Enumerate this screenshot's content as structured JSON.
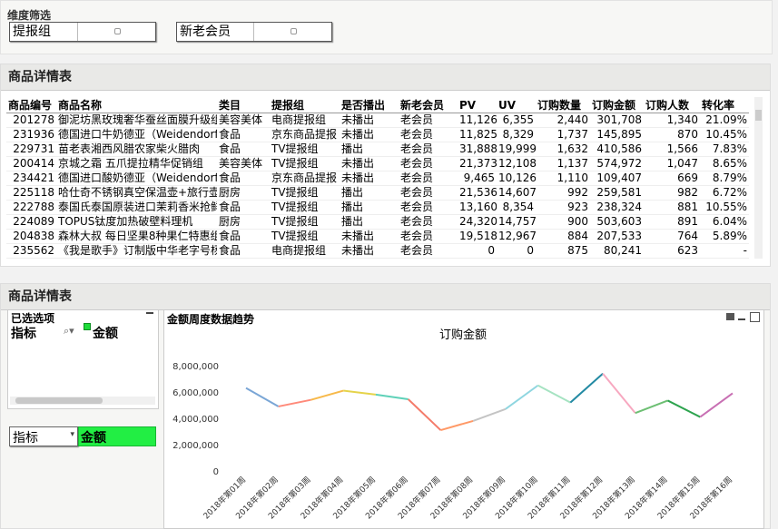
{
  "filter": {
    "title": "维度筛选",
    "combo1_label": "提报组",
    "combo2_label": "新老会员"
  },
  "table_panel": {
    "title": "商品详情表",
    "columns": [
      "商品编号",
      "商品名称",
      "类目",
      "提报组",
      "是否播出",
      "新老会员",
      "PV",
      "UV",
      "订购数量",
      "订购金额",
      "订购人数",
      "转化率"
    ],
    "rows": [
      [
        "201278",
        "御泥坊黑玫瑰奢华蚕丝面膜升级组",
        "美容美体",
        "电商提报组",
        "未播出",
        "老会员",
        "11,126",
        "6,355",
        "2,440",
        "301,708",
        "1,340",
        "21.09%"
      ],
      [
        "231936",
        "德国进口牛奶德亚（Weidendorf",
        "食品",
        "京东商品提报",
        "未播出",
        "老会员",
        "11,825",
        "8,329",
        "1,737",
        "145,895",
        "870",
        "10.45%"
      ],
      [
        "229731",
        "苗老表湘西风腊农家柴火腊肉",
        "食品",
        "TV提报组",
        "播出",
        "老会员",
        "31,888",
        "19,999",
        "1,632",
        "410,586",
        "1,566",
        "7.83%"
      ],
      [
        "200414",
        "京城之霜 五爪提拉精华促销组",
        "美容美体",
        "TV提报组",
        "未播出",
        "老会员",
        "21,373",
        "12,108",
        "1,137",
        "574,972",
        "1,047",
        "8.65%"
      ],
      [
        "234421",
        "德国进口酸奶德亚（Weidendorf",
        "食品",
        "京东商品提报",
        "未播出",
        "老会员",
        "9,465",
        "10,126",
        "1,110",
        "109,407",
        "669",
        "8.79%"
      ],
      [
        "225118",
        "哈仕奇不锈钢真空保温壶+旅行壶",
        "厨房",
        "TV提报组",
        "播出",
        "老会员",
        "21,536",
        "14,607",
        "992",
        "259,581",
        "982",
        "6.72%"
      ],
      [
        "222788",
        "泰国氏泰国原装进口茉莉香米抢鲜",
        "食品",
        "TV提报组",
        "播出",
        "老会员",
        "13,160",
        "8,354",
        "923",
        "238,324",
        "881",
        "10.55%"
      ],
      [
        "224089",
        "TOPUS钛度加热破壁料理机",
        "厨房",
        "TV提报组",
        "播出",
        "老会员",
        "24,320",
        "14,757",
        "900",
        "503,603",
        "891",
        "6.04%"
      ],
      [
        "204838",
        "森林大叔 每日坚果8种果仁特惠组",
        "食品",
        "TV提报组",
        "未播出",
        "老会员",
        "19,518",
        "12,967",
        "884",
        "207,533",
        "764",
        "5.89%"
      ],
      [
        "235562",
        "《我是歌手》订制版中华老字号杨",
        "食品",
        "电商提报组",
        "未播出",
        "老会员",
        "0",
        "0",
        "875",
        "80,241",
        "623",
        "-"
      ]
    ]
  },
  "bottom_panel": {
    "title": "商品详情表",
    "selected_title": "已选选项",
    "indicator_label": "指标",
    "indicator_value": "金额",
    "indicator_combo_label": "指标",
    "indicator_combo_value": "金额",
    "chart_window_title": "金额周度数据趋势"
  },
  "chart_data": {
    "type": "line",
    "title": "订购金额",
    "categories": [
      "2018年第01周",
      "2018年第02周",
      "2018年第03周",
      "2018年第04周",
      "2018年第05周",
      "2018年第06周",
      "2018年第07周",
      "2018年第08周",
      "2018年第09周",
      "2018年第10周",
      "2018年第11周",
      "2018年第12周",
      "2018年第13周",
      "2018年第14周",
      "2018年第15周",
      "2018年第16周"
    ],
    "values": [
      6300000,
      4900000,
      5400000,
      6100000,
      5800000,
      5450000,
      3100000,
      3800000,
      4700000,
      6500000,
      5200000,
      7400000,
      4400000,
      5350000,
      4100000,
      5900000
    ],
    "yticks": [
      "0",
      "2,000,000",
      "4,000,000",
      "6,000,000",
      "8,000,000"
    ],
    "ylim": [
      0,
      8000000
    ],
    "segment_colors": [
      "#7aa6d6",
      "#ff8a7a",
      "#f7b94a",
      "#e5d34a",
      "#5ed1b8",
      "#f47b6a",
      "#ff9966",
      "#c4c4c4",
      "#8fd6e0",
      "#a6e3c2",
      "#238aa3",
      "#f7a8c0",
      "#6dbf73",
      "#2ea44f",
      "#c86fb3",
      "#d32d2d"
    ]
  }
}
